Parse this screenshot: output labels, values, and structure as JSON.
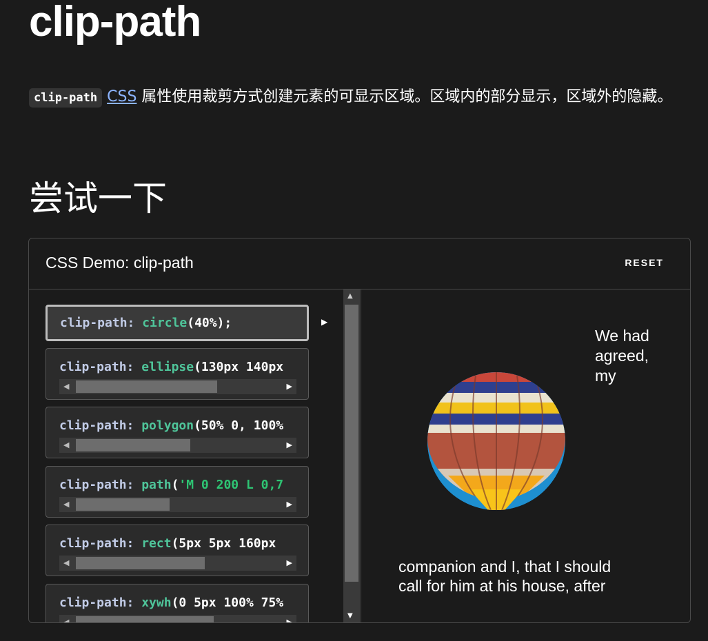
{
  "page": {
    "title": "clip-path",
    "intro": {
      "code": "clip-path",
      "link": "CSS",
      "rest": " 属性使用裁剪方式创建元素的可显示区域。区域内的部分显示，区域外的隐藏。"
    },
    "section_heading": "尝试一下"
  },
  "demo": {
    "title": "CSS Demo: clip-path",
    "reset_label": "RESET",
    "options": [
      {
        "prop": "clip-path:",
        "fn": "circle",
        "args": "(40%);"
      },
      {
        "prop": "clip-path:",
        "fn": "ellipse",
        "args": "(130px 140px"
      },
      {
        "prop": "clip-path:",
        "fn": "polygon",
        "args": "(50% 0, 100%"
      },
      {
        "prop": "clip-path:",
        "fn": "path",
        "args_open": "(",
        "args_str": "'M 0 200 L 0,7"
      },
      {
        "prop": "clip-path:",
        "fn": "rect",
        "args": "(5px 5px 160px"
      },
      {
        "prop": "clip-path:",
        "fn": "xywh",
        "args": "(0 5px 100% 75%"
      }
    ],
    "output_text": {
      "line1": "We had",
      "line2": "agreed,",
      "line3": "my",
      "line4": "companion and I, that I should",
      "line5": "call for him at his house, after"
    }
  },
  "colors": {
    "background": "#1b1b1b",
    "link": "#8cb4ff",
    "function": "#4fc59a",
    "string": "#2ec473",
    "property": "#c1cbe6"
  },
  "icons": [
    "play-arrow-icon",
    "scroll-up-arrow-icon",
    "scroll-down-arrow-icon",
    "scroll-left-arrow-icon",
    "scroll-right-arrow-icon"
  ]
}
